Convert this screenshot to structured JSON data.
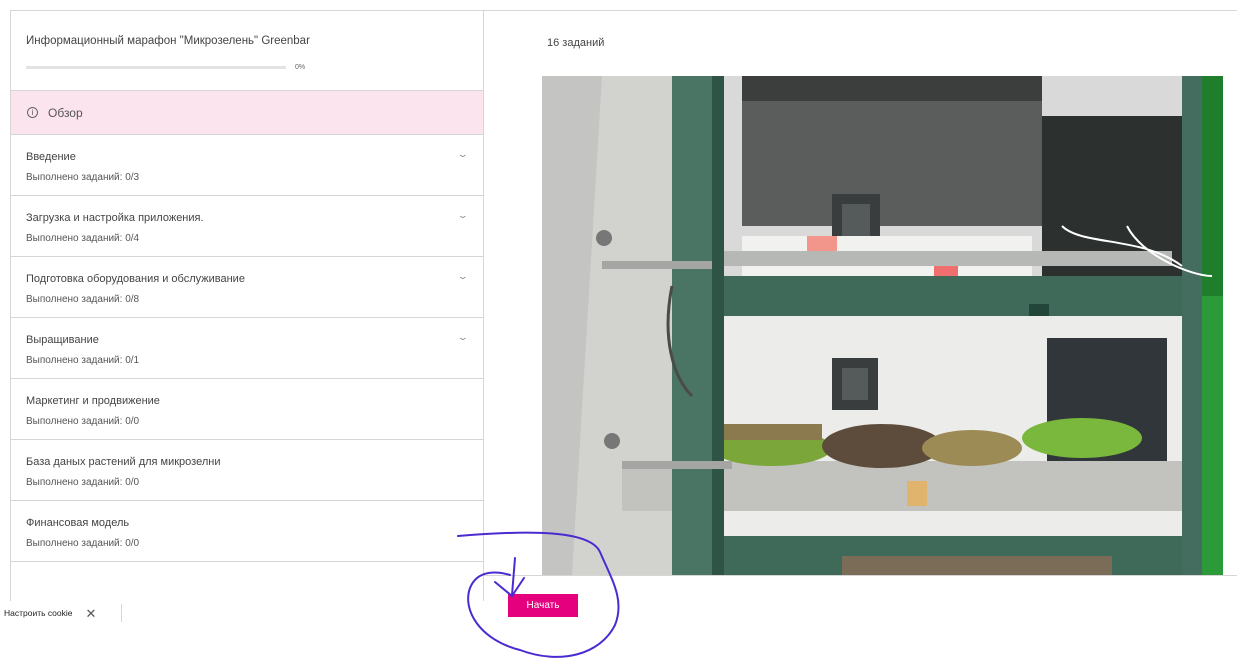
{
  "course": {
    "title": "Информационный марафон \"Микрозелень\" Greenbar",
    "progress_percent": 0,
    "progress_label": "0%"
  },
  "overview": {
    "label": "Обзор",
    "icon": "info-icon"
  },
  "sections": [
    {
      "title": "Введение",
      "sub": "Выполнено заданий: 0/3",
      "expandable": true
    },
    {
      "title": "Загрузка и настройка приложения.",
      "sub": "Выполнено заданий: 0/4",
      "expandable": true
    },
    {
      "title": "Подготовка оборудования и обслуживание",
      "sub": "Выполнено заданий: 0/8",
      "expandable": true
    },
    {
      "title": "Выращивание",
      "sub": "Выполнено заданий: 0/1",
      "expandable": true
    },
    {
      "title": "Маркетинг и продвижение",
      "sub": "Выполнено заданий: 0/0",
      "expandable": false
    },
    {
      "title": "База даных растений для микрозелни",
      "sub": "Выполнено заданий: 0/0",
      "expandable": false
    },
    {
      "title": "Финансовая модель",
      "sub": "Выполнено заданий: 0/0",
      "expandable": false
    }
  ],
  "main": {
    "task_count": "16 заданий",
    "start_label": "Начать"
  },
  "cookie": {
    "label": "Настроить cookie",
    "close": "✕"
  },
  "colors": {
    "accent": "#e5007e",
    "overview_bg": "#fce4ef",
    "annotation": "#4b2bd1"
  }
}
